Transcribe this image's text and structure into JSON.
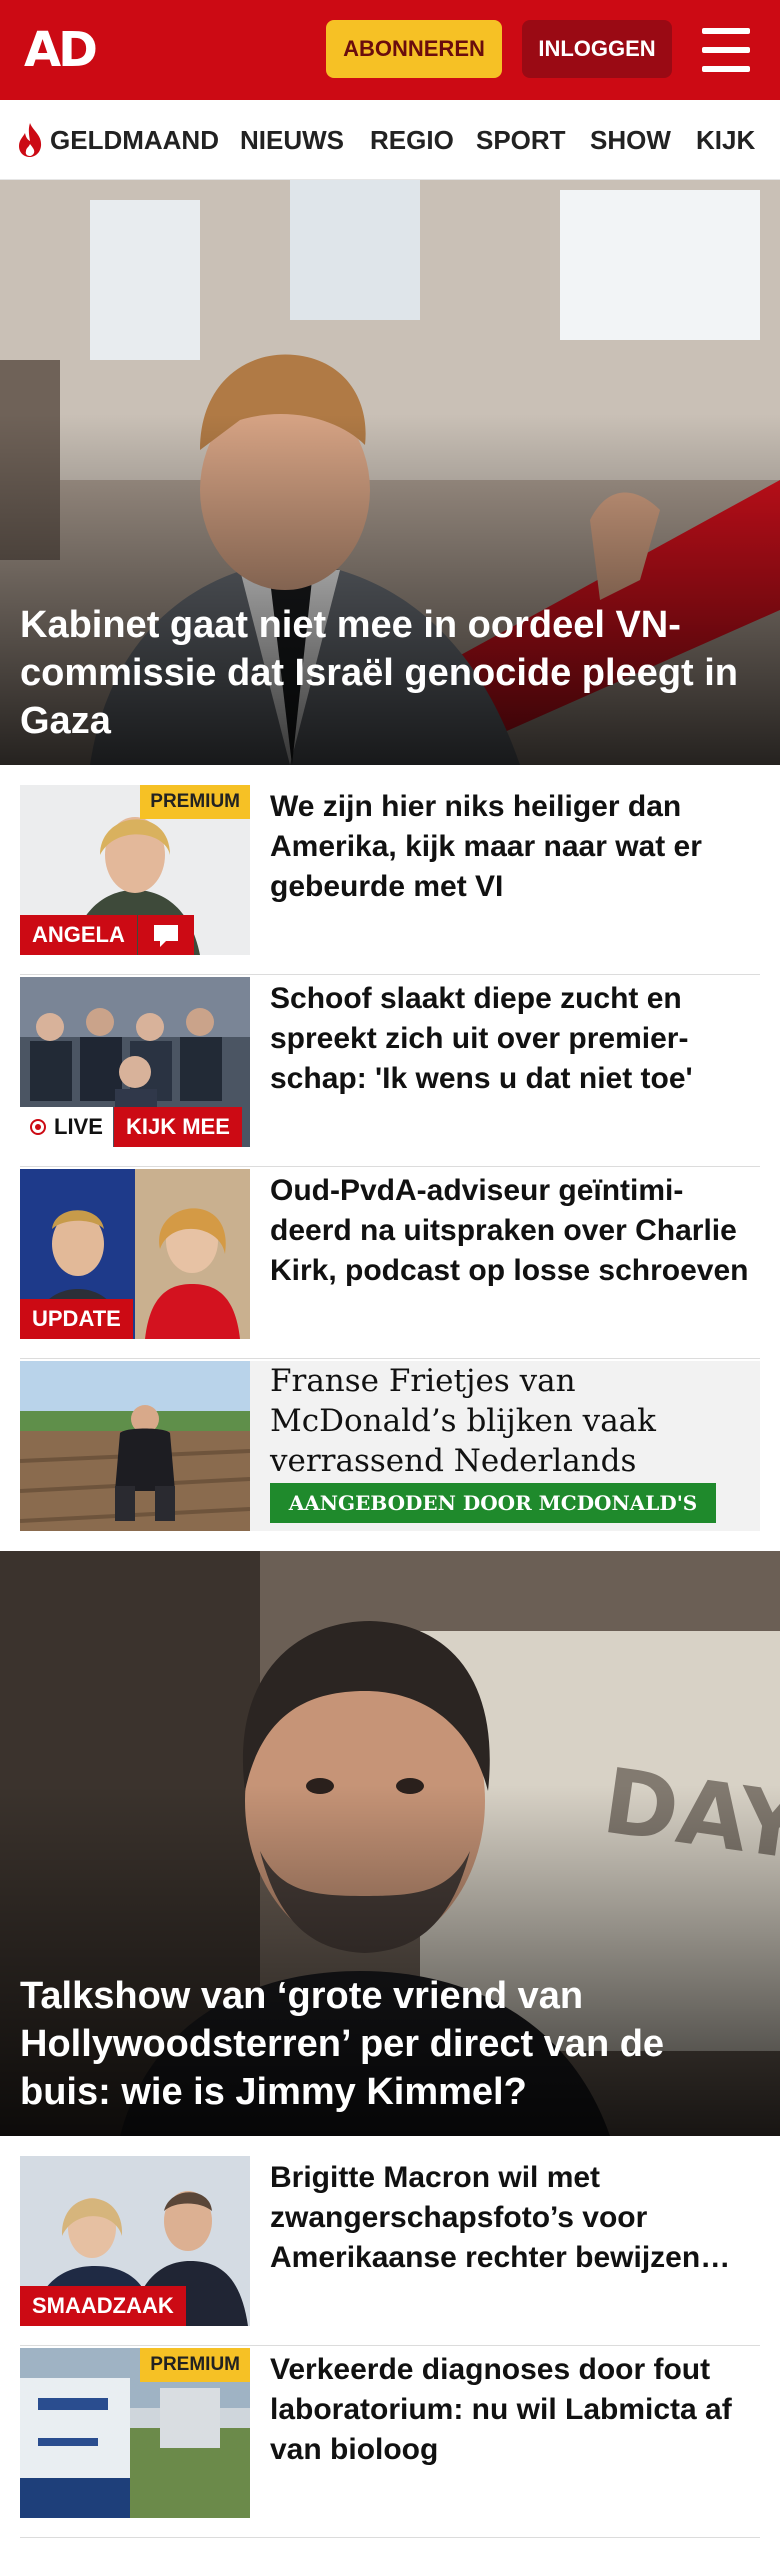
{
  "header": {
    "logo": "AD",
    "subscribe_label": "ABONNEREN",
    "login_label": "INLOGGEN",
    "brand_color": "#cc0a14"
  },
  "nav": {
    "items": [
      "GELDMAAND",
      "NIEUWS",
      "REGIO",
      "SPORT",
      "SHOW",
      "KIJK"
    ]
  },
  "hero1": {
    "title": "Kabinet gaat niet mee in oordeel VN-commissie dat Israël genocide pleegt in Gaza"
  },
  "articles1": [
    {
      "title": "We zijn hier niks heiliger dan Amerika, kijk maar naar wat er gebeurde met VI",
      "label": "ANGELA",
      "premium": "PREMIUM"
    },
    {
      "title": "Schoof slaakt diepe zucht en spreekt zich uit over premier-schap: 'Ik wens u dat niet toe'",
      "live": "LIVE",
      "label": "KIJK MEE"
    },
    {
      "title": "Oud-PvdA-adviseur geïntimi-deerd na uitspraken over Charlie Kirk, podcast op losse schroeven",
      "label": "UPDATE"
    }
  ],
  "ad": {
    "title": "Franse Frietjes van McDonald’s blijken vaak verrassend Nederlands",
    "badge": "AANGEBODEN DOOR MCDONALD'S"
  },
  "hero2": {
    "title": "Talkshow van ‘grote vriend van Hollywoodsterren’ per direct van de buis: wie is Jimmy Kimmel?"
  },
  "articles2": [
    {
      "title": "Brigitte Macron wil met zwangerschapsfoto’s voor Amerikaanse rechter bewijzen…",
      "label": "SMAADZAAK"
    },
    {
      "title": "Verkeerde diagnoses door fout laboratorium: nu wil Labmicta af van bioloog",
      "premium": "PREMIUM"
    }
  ]
}
